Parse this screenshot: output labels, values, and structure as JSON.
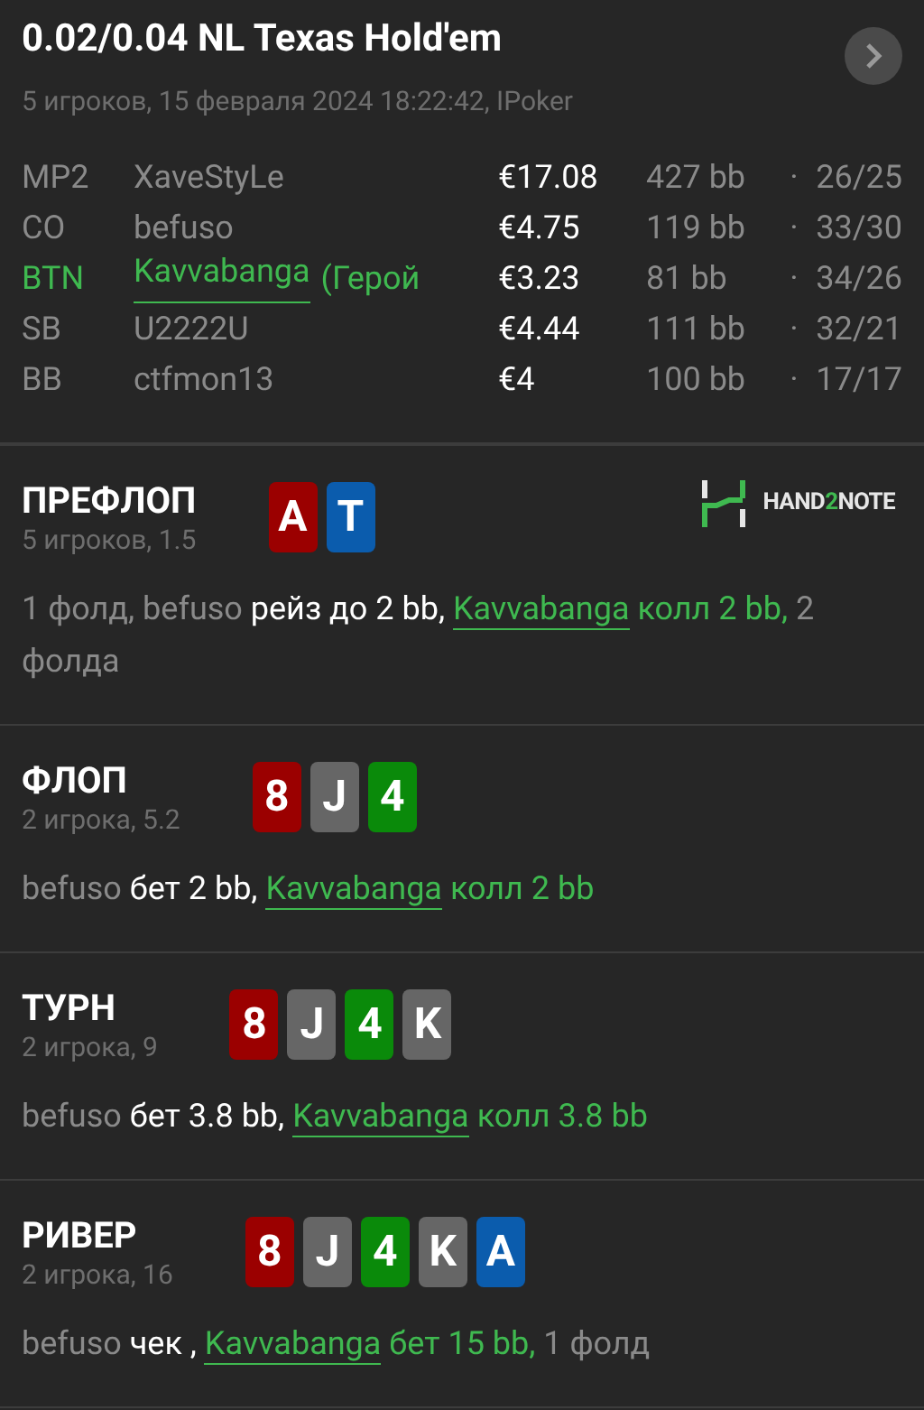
{
  "header": {
    "title": "0.02/0.04 NL Texas Hold'em",
    "subtitle": "5 игроков, 15 февраля 2024 18:22:42, IPoker"
  },
  "players": [
    {
      "position": "MP2",
      "name": "XaveStyLe",
      "hero": false,
      "stack": "€17.08",
      "bb": "427 bb",
      "stats": "26/25"
    },
    {
      "position": "CO",
      "name": "befuso",
      "hero": false,
      "stack": "€4.75",
      "bb": "119 bb",
      "stats": "33/30"
    },
    {
      "position": "BTN",
      "name": "Kavvabanga",
      "suffix": "(Герой",
      "hero": true,
      "stack": "€3.23",
      "bb": "81 bb",
      "stats": "34/26"
    },
    {
      "position": "SB",
      "name": "U2222U",
      "hero": false,
      "stack": "€4.44",
      "bb": "111 bb",
      "stats": "32/21"
    },
    {
      "position": "BB",
      "name": "ctfmon13",
      "hero": false,
      "stack": "€4",
      "bb": "100 bb",
      "stats": "17/17"
    }
  ],
  "separator": "·",
  "logo": {
    "before": "HAND",
    "accent": "2",
    "after": "NOTE"
  },
  "streets": [
    {
      "title": "ПРЕФЛОП",
      "subtitle": "5 игроков, 1.5",
      "logo": true,
      "cards": [
        {
          "rank": "A",
          "color": "#9b0000"
        },
        {
          "rank": "T",
          "color": "#0b5cad"
        }
      ],
      "actions": [
        {
          "kind": "plain",
          "text": "1 фолд, "
        },
        {
          "kind": "player",
          "text": "befuso"
        },
        {
          "kind": "action",
          "text": " рейз до 2 bb, "
        },
        {
          "kind": "hero",
          "text": "Kavvabanga"
        },
        {
          "kind": "hero_action",
          "text": " колл 2 bb,"
        },
        {
          "kind": "plain",
          "text": " 2 фолда"
        }
      ]
    },
    {
      "title": "ФЛОП",
      "subtitle": "2 игрока, 5.2",
      "logo": false,
      "cards": [
        {
          "rank": "8",
          "color": "#9b0000"
        },
        {
          "rank": "J",
          "color": "#666666"
        },
        {
          "rank": "4",
          "color": "#0a8a0a"
        }
      ],
      "actions": [
        {
          "kind": "player",
          "text": "befuso"
        },
        {
          "kind": "action",
          "text": " бет 2 bb, "
        },
        {
          "kind": "hero",
          "text": "Kavvabanga"
        },
        {
          "kind": "hero_action",
          "text": " колл 2 bb"
        }
      ]
    },
    {
      "title": "ТУРН",
      "subtitle": "2 игрока, 9",
      "logo": false,
      "cards": [
        {
          "rank": "8",
          "color": "#9b0000"
        },
        {
          "rank": "J",
          "color": "#666666"
        },
        {
          "rank": "4",
          "color": "#0a8a0a"
        },
        {
          "rank": "K",
          "color": "#666666"
        }
      ],
      "actions": [
        {
          "kind": "player",
          "text": "befuso"
        },
        {
          "kind": "action",
          "text": " бет 3.8 bb, "
        },
        {
          "kind": "hero",
          "text": "Kavvabanga"
        },
        {
          "kind": "hero_action",
          "text": " колл 3.8 bb"
        }
      ]
    },
    {
      "title": "РИВЕР",
      "subtitle": "2 игрока, 16",
      "logo": false,
      "cards": [
        {
          "rank": "8",
          "color": "#9b0000"
        },
        {
          "rank": "J",
          "color": "#666666"
        },
        {
          "rank": "4",
          "color": "#0a8a0a"
        },
        {
          "rank": "K",
          "color": "#666666"
        },
        {
          "rank": "A",
          "color": "#0b5cad"
        }
      ],
      "actions": [
        {
          "kind": "player",
          "text": "befuso"
        },
        {
          "kind": "action",
          "text": " чек , "
        },
        {
          "kind": "hero",
          "text": "Kavvabanga"
        },
        {
          "kind": "hero_action",
          "text": " бет 15 bb,"
        },
        {
          "kind": "plain",
          "text": " 1 фолд"
        }
      ]
    }
  ]
}
